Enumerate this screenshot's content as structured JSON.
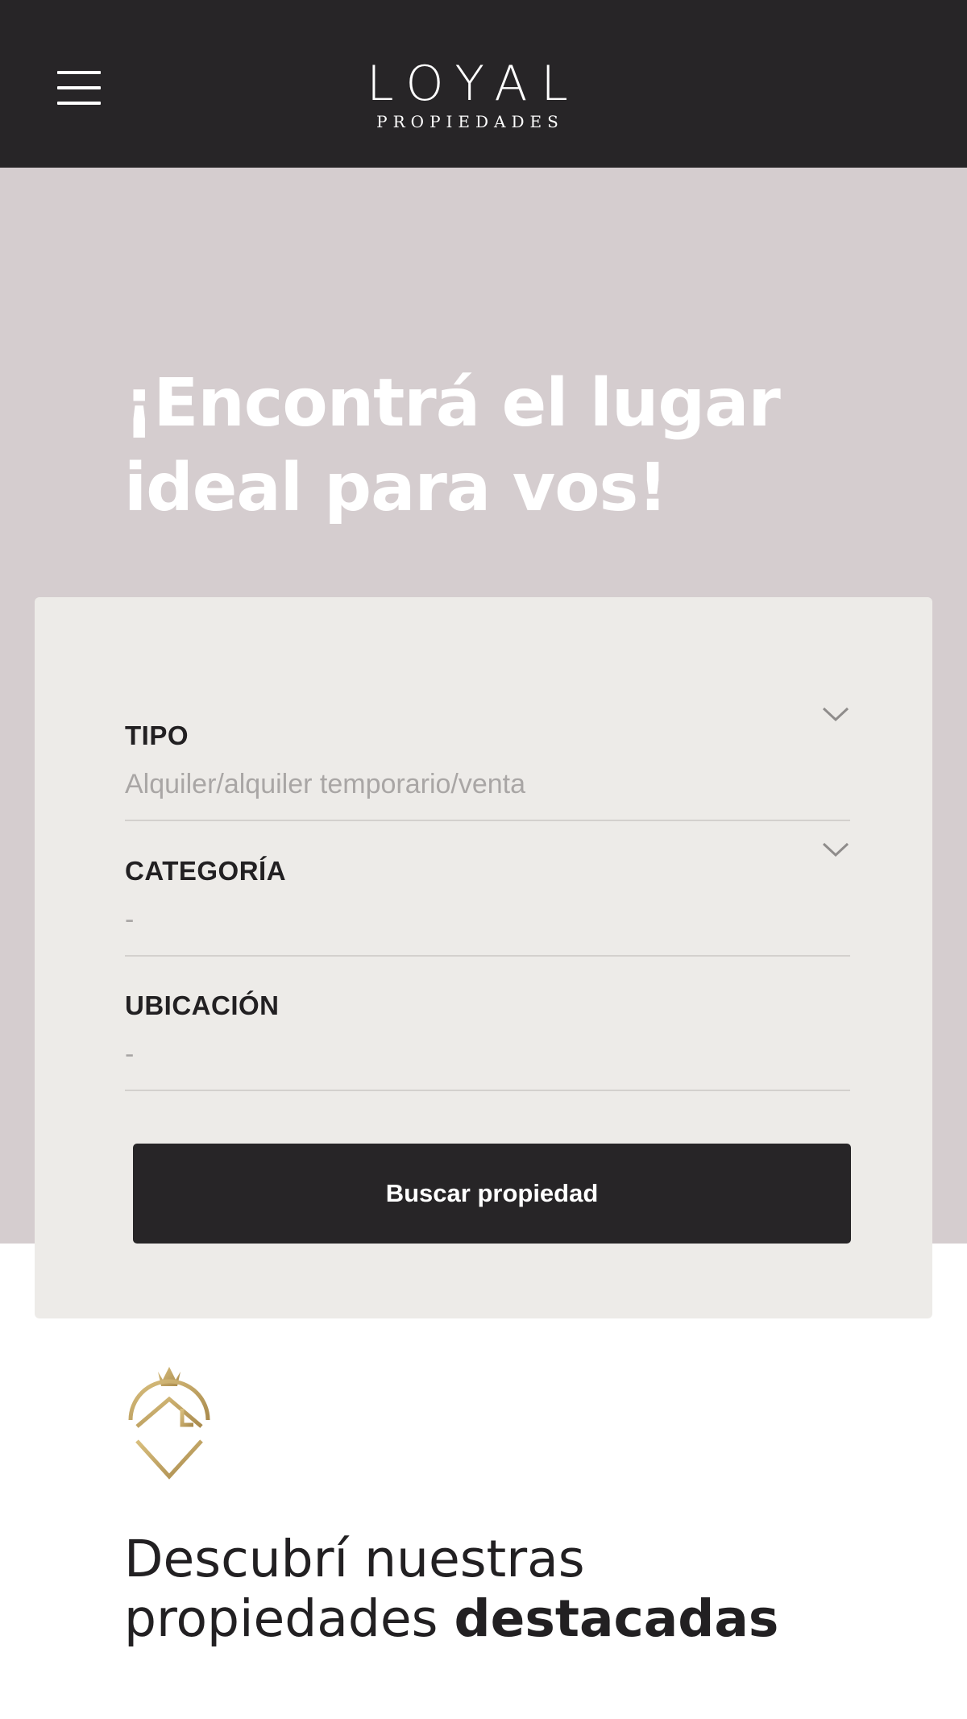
{
  "header": {
    "menu_icon": "hamburger-menu-icon",
    "logo_word": "LOYAL",
    "logo_sub": "PROPIEDADES",
    "background": "#272527"
  },
  "hero": {
    "title": "¡Encontrá el lugar ideal para vos!",
    "background": "#d5cdcf"
  },
  "search": {
    "fields": [
      {
        "label": "TIPO",
        "value": "Alquiler/alquiler temporario/venta",
        "icon": "chevron-down-icon"
      },
      {
        "label": "CATEGORÍA",
        "value": "-",
        "icon": "chevron-down-icon"
      },
      {
        "label": "UBICACIÓN",
        "value": "-"
      }
    ],
    "button_label": "Buscar propiedad"
  },
  "featured": {
    "emblem_icon": "house-pin-crown-icon",
    "title_regular": "Descubrí nuestras propiedades ",
    "title_bold": "destacadas",
    "accent_color": "#c2a462"
  }
}
